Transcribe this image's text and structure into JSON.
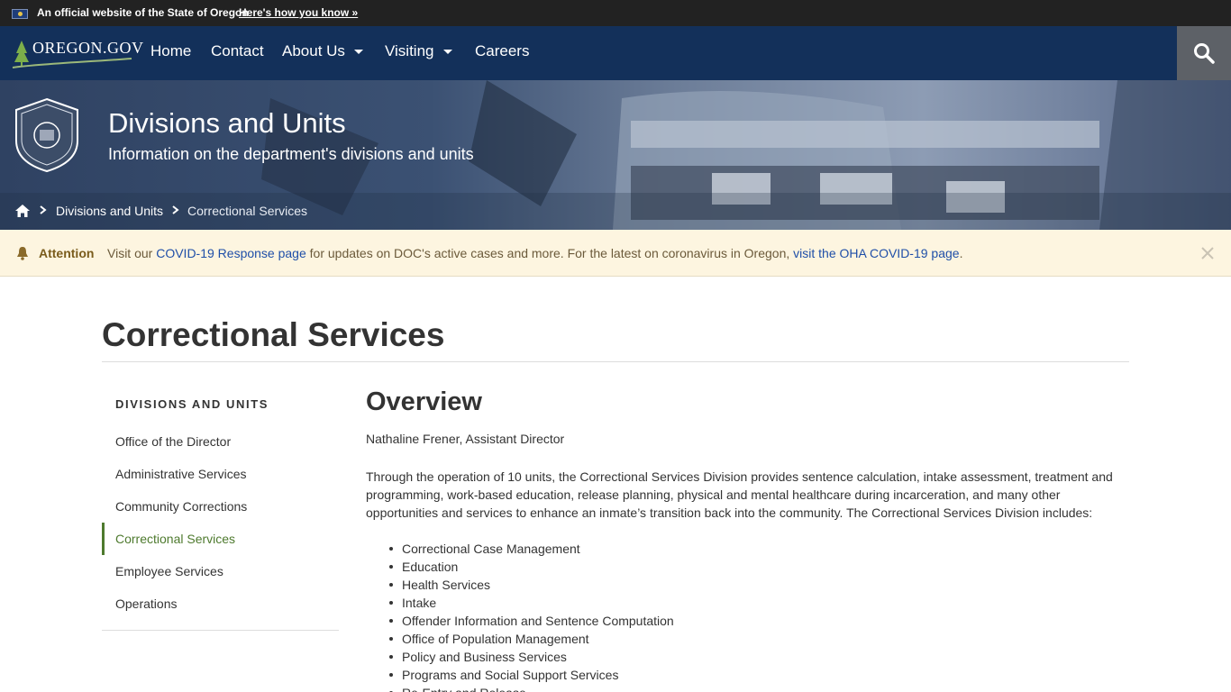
{
  "official_banner": {
    "text": "An official website of the State of Oregon",
    "link": "Here's how you know »"
  },
  "nav": {
    "logo_text": "OREGON.GOV",
    "items": [
      {
        "label": "Home"
      },
      {
        "label": "Contact"
      },
      {
        "label": "About Us"
      },
      {
        "label": "Visiting"
      },
      {
        "label": "Careers"
      }
    ],
    "search_icon": "search-icon"
  },
  "hero": {
    "title": "Divisions and Units",
    "subtitle": "Information on the department's divisions and units"
  },
  "breadcrumb": {
    "items": [
      {
        "label": "Divisions and Units"
      },
      {
        "label": "Correctional Services"
      }
    ]
  },
  "alert": {
    "label": "Attention",
    "text_1": "Visit our ",
    "link_1": "COVID-19 Response page",
    "text_2": " for updates on DOC's active cases and more. For the latest on coronavirus in Oregon, ",
    "link_2": "visit the OHA COVID-19 page",
    "text_3": "."
  },
  "page": {
    "title": "Correctional Services"
  },
  "sidenav": {
    "heading": "DIVISIONS AND UNITS",
    "items": [
      {
        "label": "Office of the Director"
      },
      {
        "label": "Administrative Services"
      },
      {
        "label": "Community Corrections"
      },
      {
        "label": "Correctional Services"
      },
      {
        "label": "Employee Services"
      },
      {
        "label": "Operations"
      }
    ],
    "active_color": "#4e7a2e"
  },
  "main": {
    "heading": "Overview",
    "director": "Nathaline Frener, Assistant Director",
    "intro": "Through the operation of 10 units, the Correctional Services Division provides sentence calculation, intake assessment, treatment and programming, work-based education, release planning, physical and mental healthcare during incarceration, and many other opportunities and services to enhance an inmate’s transition back into the community. The Correctional Services Division includes:",
    "units": [
      "Correctional Case Management",
      "Education",
      "Health Services",
      "Intake",
      "Offender Information and Sentence Computation",
      "Office of Population Management",
      "Policy and Business Services",
      "Programs and Social Support Services",
      "Re-Entry and Release"
    ]
  },
  "colors": {
    "nav_bg": "#13305a",
    "official_bg": "#222222",
    "alert_bg": "#fdf5e0",
    "link": "#1f4fa8"
  }
}
